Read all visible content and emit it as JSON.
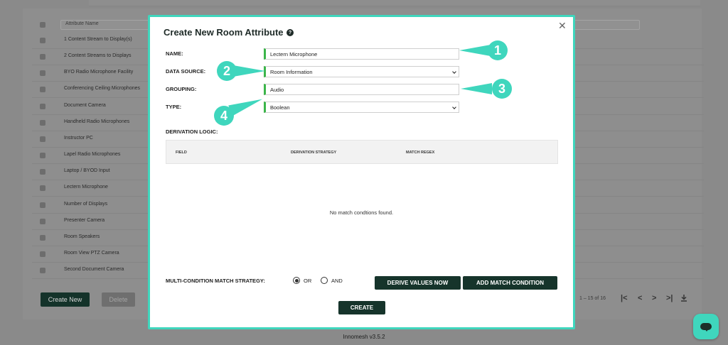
{
  "background": {
    "filter_placeholder": "Attribute Name",
    "rows": [
      "1 Content Stream to Display(s)",
      "2 Content Streams to Displays",
      "BYO Radio Microphone Facility",
      "Conferencing Ceiling Microphones",
      "Document Camera",
      "Handheld Radio Microphones",
      "Instructor PC",
      "Lapel Radio Microphones",
      "Laptop / BYOD Input",
      "Lectern Microphone",
      "Number of Displays",
      "Presenter Camera",
      "Room Speakers",
      "Room View PTZ Camera",
      "Second Document Camera"
    ],
    "create_new_label": "Create New",
    "delete_label": "Delete",
    "page_info": "1 – 15 of 16",
    "footer": "Innomesh v3.5.2"
  },
  "modal": {
    "title": "Create New Room Attribute",
    "help_glyph": "?",
    "close_glyph": "✕",
    "name_label": "NAME:",
    "name_value": "Lectern Microphone",
    "data_source_label": "DATA SOURCE:",
    "data_source_value": "Room Information",
    "grouping_label": "GROUPING:",
    "grouping_value": "Audio",
    "type_label": "TYPE:",
    "type_value": "Boolean",
    "derivation_label": "DERIVATION LOGIC:",
    "table_headers": [
      "FIELD",
      "DERIVATION STRATEGY",
      "MATCH REGEX"
    ],
    "empty_message": "No match condtions found.",
    "strategy_label": "MULTI-CONDITION MATCH STRATEGY:",
    "strategy_or": "OR",
    "strategy_and": "AND",
    "strategy_selected": "OR",
    "derive_button": "DERIVE VALUES NOW",
    "add_condition_button": "ADD MATCH CONDITION",
    "create_button": "CREATE"
  },
  "callouts": [
    "1",
    "2",
    "3",
    "4"
  ],
  "colors": {
    "accent": "#3fd6bd",
    "field_marker": "#3bb54a",
    "button_dark": "#16342b"
  },
  "icons": [
    "help-icon",
    "close-icon",
    "chevron-down-icon",
    "chat-icon",
    "first-page-icon",
    "prev-page-icon",
    "next-page-icon",
    "last-page-icon",
    "download-icon"
  ]
}
